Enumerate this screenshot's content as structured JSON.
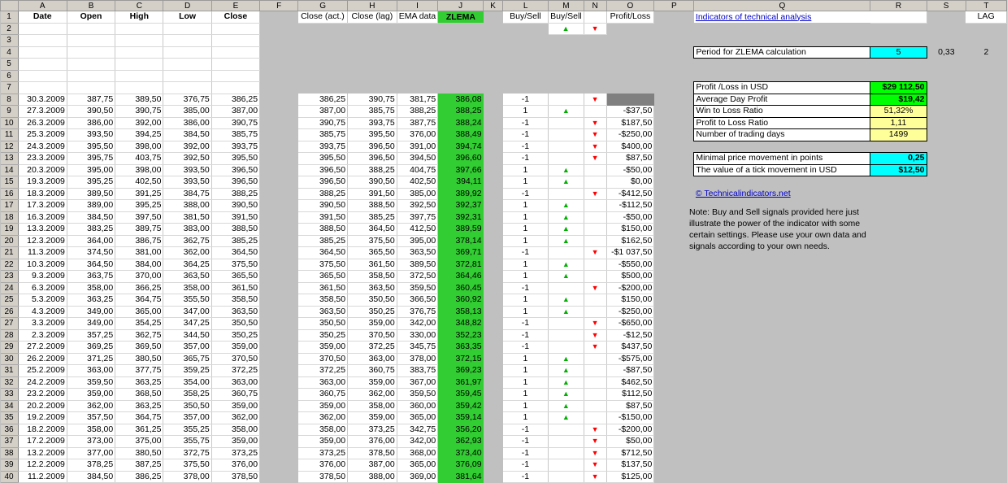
{
  "columns": [
    "A",
    "B",
    "C",
    "D",
    "E",
    "F",
    "G",
    "H",
    "I",
    "J",
    "K",
    "L",
    "M",
    "N",
    "O",
    "P",
    "Q",
    "R",
    "S",
    "T"
  ],
  "headers": {
    "date": "Date",
    "open": "Open",
    "high": "High",
    "low": "Low",
    "close": "Close",
    "close_act": "Close (act.)",
    "close_lag": "Close (lag)",
    "ema": "EMA data",
    "zlema": "ZLEMA",
    "buysell1": "Buy/Sell",
    "buysell2": "Buy/Sell",
    "pl": "Profit/Loss",
    "q_title": "Indicators of technical analysis",
    "t_lag": "LAG"
  },
  "params": {
    "period_label": "Period for ZLEMA calculation",
    "period_value": "5",
    "s4": "0,33",
    "t4": "2",
    "pl_usd_label": "Profit /Loss in USD",
    "pl_usd_value": "$29 112,50",
    "avg_label": "Average Day Profit",
    "avg_value": "$19,42",
    "win_label": "Win to Loss Ratio",
    "win_value": "51,32%",
    "pr_label": "Profit to Loss Ratio",
    "pr_value": "1,11",
    "days_label": "Number of trading days",
    "days_value": "1499",
    "minprice_label": "Minimal price movement in points",
    "minprice_value": "0,25",
    "tick_label": "The value of a tick movement in USD",
    "tick_value": "$12,50",
    "link": "© Technicalindicators.net",
    "note": "Note: Buy and Sell signals provided here just illustrate the power of the indicator with some certain settings. Please use your own data and signals according to your own needs."
  },
  "rows": [
    [
      "30.3.2009",
      "387,75",
      "389,50",
      "376,75",
      "386,25",
      "386,25",
      "390,75",
      "381,75",
      "386,08",
      "-1",
      "",
      "dn",
      ""
    ],
    [
      "27.3.2009",
      "390,50",
      "390,75",
      "385,00",
      "387,00",
      "387,00",
      "385,75",
      "388,25",
      "388,25",
      "1",
      "up",
      "",
      "-$37,50"
    ],
    [
      "26.3.2009",
      "386,00",
      "392,00",
      "386,00",
      "390,75",
      "390,75",
      "393,75",
      "387,75",
      "388,24",
      "-1",
      "",
      "dn",
      "$187,50"
    ],
    [
      "25.3.2009",
      "393,50",
      "394,25",
      "384,50",
      "385,75",
      "385,75",
      "395,50",
      "376,00",
      "388,49",
      "-1",
      "",
      "dn",
      "-$250,00"
    ],
    [
      "24.3.2009",
      "395,50",
      "398,00",
      "392,00",
      "393,75",
      "393,75",
      "396,50",
      "391,00",
      "394,74",
      "-1",
      "",
      "dn",
      "$400,00"
    ],
    [
      "23.3.2009",
      "395,75",
      "403,75",
      "392,50",
      "395,50",
      "395,50",
      "396,50",
      "394,50",
      "396,60",
      "-1",
      "",
      "dn",
      "$87,50"
    ],
    [
      "20.3.2009",
      "395,00",
      "398,00",
      "393,50",
      "396,50",
      "396,50",
      "388,25",
      "404,75",
      "397,66",
      "1",
      "up",
      "",
      "-$50,00"
    ],
    [
      "19.3.2009",
      "395,25",
      "402,50",
      "393,50",
      "396,50",
      "396,50",
      "390,50",
      "402,50",
      "394,11",
      "1",
      "up",
      "",
      "$0,00"
    ],
    [
      "18.3.2009",
      "389,50",
      "391,25",
      "384,75",
      "388,25",
      "388,25",
      "391,50",
      "385,00",
      "389,92",
      "-1",
      "",
      "dn",
      "-$412,50"
    ],
    [
      "17.3.2009",
      "389,00",
      "395,25",
      "388,00",
      "390,50",
      "390,50",
      "388,50",
      "392,50",
      "392,37",
      "1",
      "up",
      "",
      "-$112,50"
    ],
    [
      "16.3.2009",
      "384,50",
      "397,50",
      "381,50",
      "391,50",
      "391,50",
      "385,25",
      "397,75",
      "392,31",
      "1",
      "up",
      "",
      "-$50,00"
    ],
    [
      "13.3.2009",
      "383,25",
      "389,75",
      "383,00",
      "388,50",
      "388,50",
      "364,50",
      "412,50",
      "389,59",
      "1",
      "up",
      "",
      "$150,00"
    ],
    [
      "12.3.2009",
      "364,00",
      "386,75",
      "362,75",
      "385,25",
      "385,25",
      "375,50",
      "395,00",
      "378,14",
      "1",
      "up",
      "",
      "$162,50"
    ],
    [
      "11.3.2009",
      "374,50",
      "381,00",
      "362,00",
      "364,50",
      "364,50",
      "365,50",
      "363,50",
      "369,71",
      "-1",
      "",
      "dn",
      "-$1 037,50"
    ],
    [
      "10.3.2009",
      "364,50",
      "384,00",
      "364,25",
      "375,50",
      "375,50",
      "361,50",
      "389,50",
      "372,81",
      "1",
      "up",
      "",
      "-$550,00"
    ],
    [
      "9.3.2009",
      "363,75",
      "370,00",
      "363,50",
      "365,50",
      "365,50",
      "358,50",
      "372,50",
      "364,46",
      "1",
      "up",
      "",
      "$500,00"
    ],
    [
      "6.3.2009",
      "358,00",
      "366,25",
      "358,00",
      "361,50",
      "361,50",
      "363,50",
      "359,50",
      "360,45",
      "-1",
      "",
      "dn",
      "-$200,00"
    ],
    [
      "5.3.2009",
      "363,25",
      "364,75",
      "355,50",
      "358,50",
      "358,50",
      "350,50",
      "366,50",
      "360,92",
      "1",
      "up",
      "",
      "$150,00"
    ],
    [
      "4.3.2009",
      "349,00",
      "365,00",
      "347,00",
      "363,50",
      "363,50",
      "350,25",
      "376,75",
      "358,13",
      "1",
      "up",
      "",
      "-$250,00"
    ],
    [
      "3.3.2009",
      "349,00",
      "354,25",
      "347,25",
      "350,50",
      "350,50",
      "359,00",
      "342,00",
      "348,82",
      "-1",
      "",
      "dn",
      "-$650,00"
    ],
    [
      "2.3.2009",
      "357,25",
      "362,75",
      "344,50",
      "350,25",
      "350,25",
      "370,50",
      "330,00",
      "352,23",
      "-1",
      "",
      "dn",
      "-$12,50"
    ],
    [
      "27.2.2009",
      "369,25",
      "369,50",
      "357,00",
      "359,00",
      "359,00",
      "372,25",
      "345,75",
      "363,35",
      "-1",
      "",
      "dn",
      "$437,50"
    ],
    [
      "26.2.2009",
      "371,25",
      "380,50",
      "365,75",
      "370,50",
      "370,50",
      "363,00",
      "378,00",
      "372,15",
      "1",
      "up",
      "",
      "-$575,00"
    ],
    [
      "25.2.2009",
      "363,00",
      "377,75",
      "359,25",
      "372,25",
      "372,25",
      "360,75",
      "383,75",
      "369,23",
      "1",
      "up",
      "",
      "-$87,50"
    ],
    [
      "24.2.2009",
      "359,50",
      "363,25",
      "354,00",
      "363,00",
      "363,00",
      "359,00",
      "367,00",
      "361,97",
      "1",
      "up",
      "",
      "$462,50"
    ],
    [
      "23.2.2009",
      "359,00",
      "368,50",
      "358,25",
      "360,75",
      "360,75",
      "362,00",
      "359,50",
      "359,45",
      "1",
      "up",
      "",
      "$112,50"
    ],
    [
      "20.2.2009",
      "362,00",
      "363,25",
      "350,50",
      "359,00",
      "359,00",
      "358,00",
      "360,00",
      "359,42",
      "1",
      "up",
      "",
      "$87,50"
    ],
    [
      "19.2.2009",
      "357,50",
      "364,75",
      "357,00",
      "362,00",
      "362,00",
      "359,00",
      "365,00",
      "359,14",
      "1",
      "up",
      "",
      "-$150,00"
    ],
    [
      "18.2.2009",
      "358,00",
      "361,25",
      "355,25",
      "358,00",
      "358,00",
      "373,25",
      "342,75",
      "356,20",
      "-1",
      "",
      "dn",
      "-$200,00"
    ],
    [
      "17.2.2009",
      "373,00",
      "375,00",
      "355,75",
      "359,00",
      "359,00",
      "376,00",
      "342,00",
      "362,93",
      "-1",
      "",
      "dn",
      "$50,00"
    ],
    [
      "13.2.2009",
      "377,00",
      "380,50",
      "372,75",
      "373,25",
      "373,25",
      "378,50",
      "368,00",
      "373,40",
      "-1",
      "",
      "dn",
      "$712,50"
    ],
    [
      "12.2.2009",
      "378,25",
      "387,25",
      "375,50",
      "376,00",
      "376,00",
      "387,00",
      "365,00",
      "376,09",
      "-1",
      "",
      "dn",
      "$137,50"
    ],
    [
      "11.2.2009",
      "384,50",
      "386,25",
      "378,00",
      "378,50",
      "378,50",
      "388,00",
      "369,00",
      "381,64",
      "-1",
      "",
      "dn",
      "$125,00"
    ]
  ],
  "arrows": {
    "up": "▲",
    "dn": "▼"
  }
}
